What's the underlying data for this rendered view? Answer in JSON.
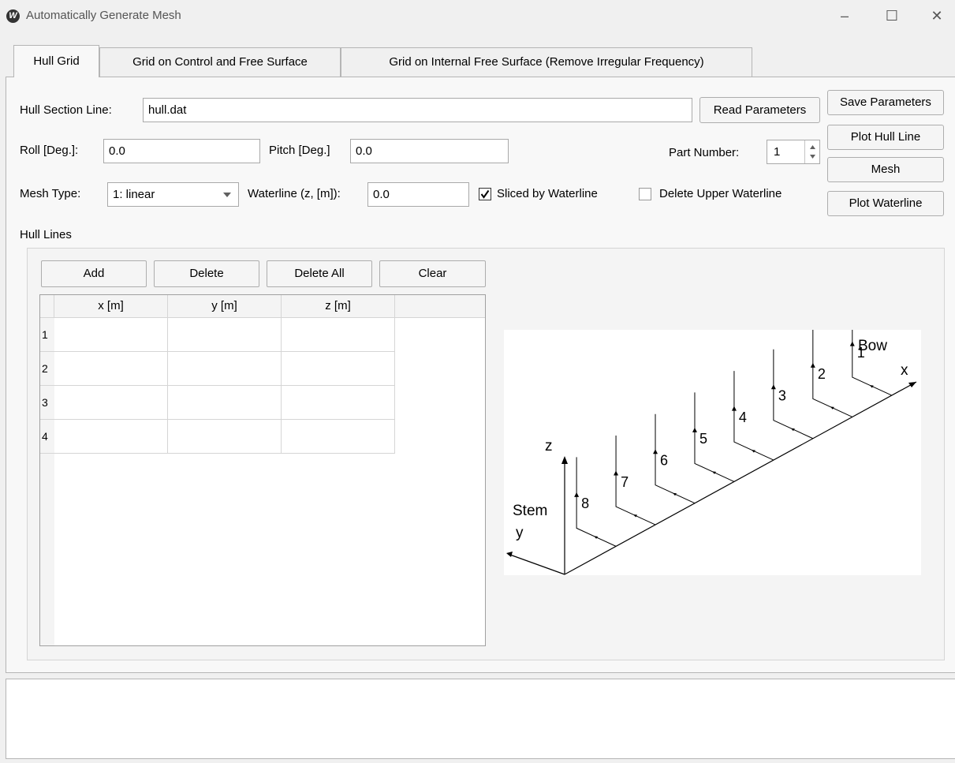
{
  "window": {
    "title": "Automatically Generate Mesh",
    "icon_letter": "W",
    "minimize": "–",
    "maximize": "☐",
    "close": "✕"
  },
  "tabs": [
    {
      "label": "Hull Grid",
      "active": true
    },
    {
      "label": "Grid on Control and Free Surface",
      "active": false
    },
    {
      "label": "Grid on Internal Free Surface (Remove Irregular Frequency)",
      "active": false
    }
  ],
  "form": {
    "hull_section_label": "Hull Section Line:",
    "hull_section_value": "hull.dat",
    "roll_label": "Roll [Deg.]:",
    "roll_value": "0.0",
    "pitch_label": "Pitch [Deg.]",
    "pitch_value": "0.0",
    "part_number_label": "Part Number:",
    "part_number_value": "1",
    "mesh_type_label": "Mesh Type:",
    "mesh_type_value": "1: linear",
    "waterline_label": "Waterline (z, [m]):",
    "waterline_value": "0.0",
    "sliced_label": "Sliced by Waterline",
    "sliced_checked": true,
    "delete_upper_label": "Delete Upper Waterline",
    "delete_upper_checked": false
  },
  "buttons": {
    "read_parameters": "Read Parameters",
    "save_parameters": "Save Parameters",
    "plot_hull_line": "Plot Hull Line",
    "mesh": "Mesh",
    "plot_waterline": "Plot Waterline"
  },
  "hull_lines": {
    "group_title": "Hull Lines",
    "add": "Add",
    "delete": "Delete",
    "delete_all": "Delete All",
    "clear": "Clear",
    "columns": [
      "x [m]",
      "y [m]",
      "z [m]"
    ],
    "rows": [
      "1",
      "2",
      "3",
      "4"
    ]
  },
  "diagram": {
    "labels": {
      "bow": "Bow",
      "stem": "Stem",
      "x": "x",
      "y": "y",
      "z": "z"
    },
    "stations": [
      "1",
      "2",
      "3",
      "4",
      "5",
      "6",
      "7",
      "8"
    ]
  }
}
